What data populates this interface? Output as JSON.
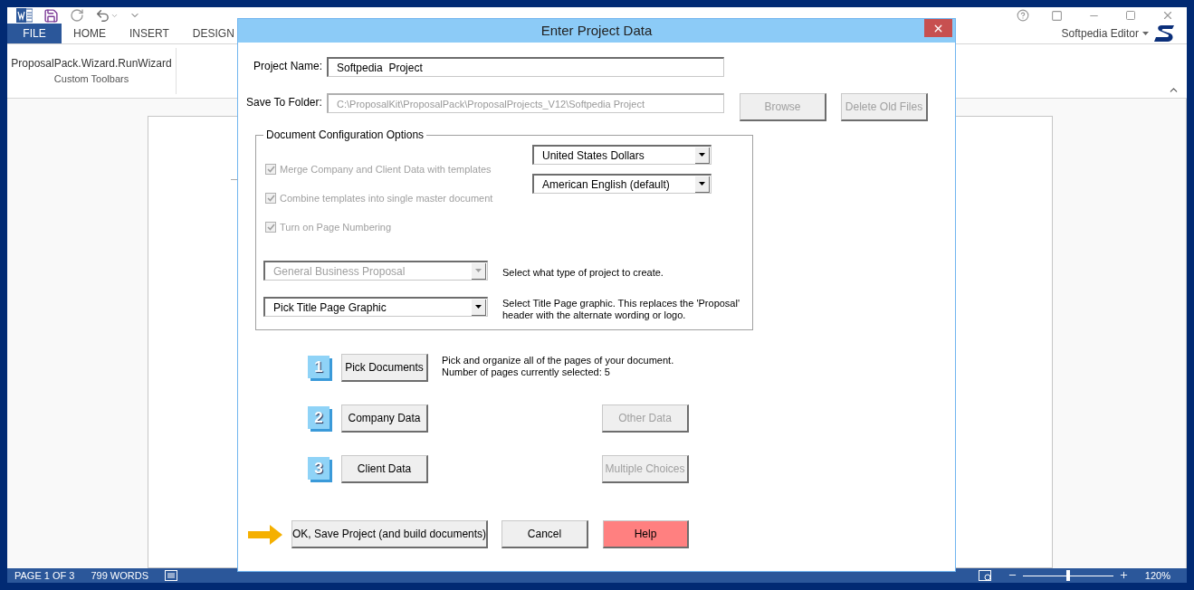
{
  "word_window": {
    "ribbon_tabs": [
      {
        "label": "FILE",
        "selected": true
      },
      {
        "label": "HOME",
        "selected": false
      },
      {
        "label": "INSERT",
        "selected": false
      },
      {
        "label": "DESIGN",
        "selected": false
      }
    ],
    "account": "Softpedia Editor",
    "ribbon_command": "ProposalPack.Wizard.RunWizard",
    "ribbon_group": "Custom Toolbars",
    "status_bar": {
      "page": "PAGE 1 OF 3",
      "words": "799 WORDS",
      "zoom": {
        "level": 0.5
      },
      "zoom_percent": "120%"
    }
  },
  "dialog": {
    "title": "Enter Project Data",
    "project_name": {
      "label": "Project Name:",
      "value": "Softpedia  Project",
      "disabled": false
    },
    "save_folder": {
      "label": "Save To Folder:",
      "value": "C:\\ProposalKit\\ProposalPack\\ProposalProjects_V12\\Softpedia Project",
      "disabled": true
    },
    "folder_buttons": [
      {
        "label": "Browse",
        "disabled": true
      },
      {
        "label": "Delete Old Files",
        "disabled": true
      }
    ],
    "options": {
      "title": "Document Configuration Options",
      "checkboxes": [
        {
          "label": "Merge Company and Client Data with templates",
          "checked": true,
          "disabled": true
        },
        {
          "label": "Combine templates into single master document",
          "checked": true,
          "disabled": true
        },
        {
          "label": "Turn on Page Numbering",
          "checked": true,
          "disabled": true
        }
      ],
      "dropdowns": [
        {
          "value": "United States Dollars",
          "disabled": false
        },
        {
          "value": "American English (default)",
          "disabled": false
        }
      ],
      "selects": [
        {
          "value": "General Business Proposal",
          "disabled": true,
          "hint": [
            "Select what type of project to create."
          ]
        },
        {
          "value": "Pick Title Page Graphic",
          "disabled": false,
          "hint": [
            "Select Title Page graphic. This replaces the 'Proposal'",
            "header with the alternate wording or logo."
          ]
        }
      ]
    },
    "steps": [
      {
        "number": "1",
        "label": "Pick Documents",
        "note": [
          "Pick and organize all of the pages of your document.",
          "Number of pages currently selected: 5"
        ]
      },
      {
        "number": "2",
        "label": "Company Data",
        "extra": {
          "label": "Other Data",
          "disabled": true
        }
      },
      {
        "number": "3",
        "label": "Client Data",
        "extra": {
          "label": "Multiple Choices",
          "disabled": true
        }
      }
    ],
    "actions": [
      {
        "label": "OK, Save Project (and build documents)",
        "kind": "primary"
      },
      {
        "label": "Cancel",
        "kind": "normal"
      },
      {
        "label": "Help",
        "kind": "help"
      }
    ]
  }
}
